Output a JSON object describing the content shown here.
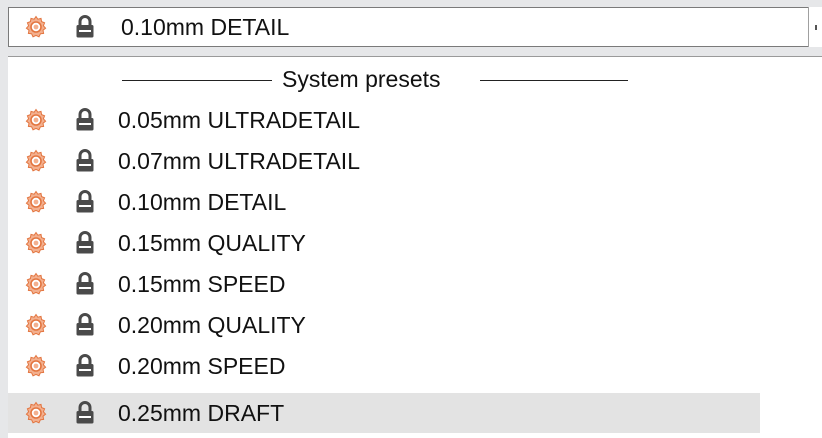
{
  "combo": {
    "selected_label": "0.10mm DETAIL",
    "icons": [
      "gear-icon",
      "lock-icon"
    ]
  },
  "dropdown": {
    "group_header": "System presets",
    "items": [
      {
        "label": "0.05mm ULTRADETAIL"
      },
      {
        "label": "0.07mm ULTRADETAIL"
      },
      {
        "label": "0.10mm DETAIL"
      },
      {
        "label": "0.15mm QUALITY"
      },
      {
        "label": "0.15mm SPEED"
      },
      {
        "label": "0.20mm QUALITY"
      },
      {
        "label": "0.20mm SPEED"
      },
      {
        "label": "0.25mm DRAFT",
        "highlighted": true
      }
    ]
  },
  "colors": {
    "gear_outer": "#f2a27b",
    "gear_inner": "#e8692e",
    "lock": "#4a4a4a",
    "highlight": "#e3e3e3"
  }
}
